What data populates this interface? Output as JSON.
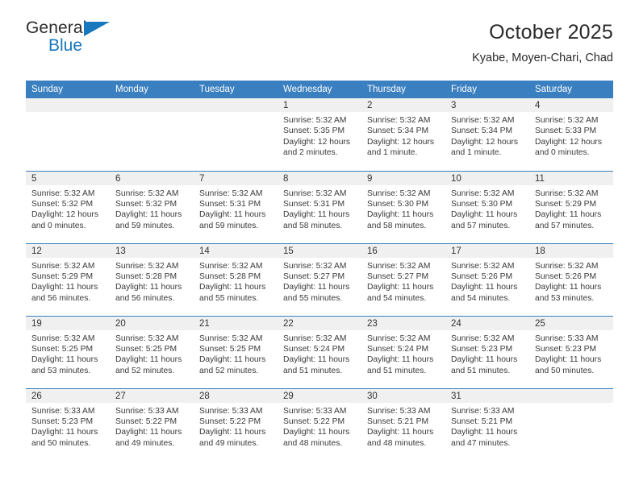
{
  "brand": {
    "name_part1": "General",
    "name_part2": "Blue",
    "accent_color": "#1878be",
    "triangle_icon": "triangle-icon"
  },
  "header": {
    "title": "October 2025",
    "subtitle": "Kyabe, Moyen-Chari, Chad"
  },
  "theme": {
    "header_row_bg": "#3a7fbf",
    "daynum_band_bg": "#f0f0f0",
    "grid_line": "#3a7fbf",
    "text": "#3a3a3a"
  },
  "weekdays": [
    "Sunday",
    "Monday",
    "Tuesday",
    "Wednesday",
    "Thursday",
    "Friday",
    "Saturday"
  ],
  "labels": {
    "sunrise": "Sunrise:",
    "sunset": "Sunset:",
    "daylight": "Daylight:"
  },
  "weeks": [
    [
      {
        "day": "",
        "info": ""
      },
      {
        "day": "",
        "info": ""
      },
      {
        "day": "",
        "info": ""
      },
      {
        "day": "1",
        "info": "Sunrise: 5:32 AM\nSunset: 5:35 PM\nDaylight: 12 hours\nand 2 minutes."
      },
      {
        "day": "2",
        "info": "Sunrise: 5:32 AM\nSunset: 5:34 PM\nDaylight: 12 hours\nand 1 minute."
      },
      {
        "day": "3",
        "info": "Sunrise: 5:32 AM\nSunset: 5:34 PM\nDaylight: 12 hours\nand 1 minute."
      },
      {
        "day": "4",
        "info": "Sunrise: 5:32 AM\nSunset: 5:33 PM\nDaylight: 12 hours\nand 0 minutes."
      }
    ],
    [
      {
        "day": "5",
        "info": "Sunrise: 5:32 AM\nSunset: 5:32 PM\nDaylight: 12 hours\nand 0 minutes."
      },
      {
        "day": "6",
        "info": "Sunrise: 5:32 AM\nSunset: 5:32 PM\nDaylight: 11 hours\nand 59 minutes."
      },
      {
        "day": "7",
        "info": "Sunrise: 5:32 AM\nSunset: 5:31 PM\nDaylight: 11 hours\nand 59 minutes."
      },
      {
        "day": "8",
        "info": "Sunrise: 5:32 AM\nSunset: 5:31 PM\nDaylight: 11 hours\nand 58 minutes."
      },
      {
        "day": "9",
        "info": "Sunrise: 5:32 AM\nSunset: 5:30 PM\nDaylight: 11 hours\nand 58 minutes."
      },
      {
        "day": "10",
        "info": "Sunrise: 5:32 AM\nSunset: 5:30 PM\nDaylight: 11 hours\nand 57 minutes."
      },
      {
        "day": "11",
        "info": "Sunrise: 5:32 AM\nSunset: 5:29 PM\nDaylight: 11 hours\nand 57 minutes."
      }
    ],
    [
      {
        "day": "12",
        "info": "Sunrise: 5:32 AM\nSunset: 5:29 PM\nDaylight: 11 hours\nand 56 minutes."
      },
      {
        "day": "13",
        "info": "Sunrise: 5:32 AM\nSunset: 5:28 PM\nDaylight: 11 hours\nand 56 minutes."
      },
      {
        "day": "14",
        "info": "Sunrise: 5:32 AM\nSunset: 5:28 PM\nDaylight: 11 hours\nand 55 minutes."
      },
      {
        "day": "15",
        "info": "Sunrise: 5:32 AM\nSunset: 5:27 PM\nDaylight: 11 hours\nand 55 minutes."
      },
      {
        "day": "16",
        "info": "Sunrise: 5:32 AM\nSunset: 5:27 PM\nDaylight: 11 hours\nand 54 minutes."
      },
      {
        "day": "17",
        "info": "Sunrise: 5:32 AM\nSunset: 5:26 PM\nDaylight: 11 hours\nand 54 minutes."
      },
      {
        "day": "18",
        "info": "Sunrise: 5:32 AM\nSunset: 5:26 PM\nDaylight: 11 hours\nand 53 minutes."
      }
    ],
    [
      {
        "day": "19",
        "info": "Sunrise: 5:32 AM\nSunset: 5:25 PM\nDaylight: 11 hours\nand 53 minutes."
      },
      {
        "day": "20",
        "info": "Sunrise: 5:32 AM\nSunset: 5:25 PM\nDaylight: 11 hours\nand 52 minutes."
      },
      {
        "day": "21",
        "info": "Sunrise: 5:32 AM\nSunset: 5:25 PM\nDaylight: 11 hours\nand 52 minutes."
      },
      {
        "day": "22",
        "info": "Sunrise: 5:32 AM\nSunset: 5:24 PM\nDaylight: 11 hours\nand 51 minutes."
      },
      {
        "day": "23",
        "info": "Sunrise: 5:32 AM\nSunset: 5:24 PM\nDaylight: 11 hours\nand 51 minutes."
      },
      {
        "day": "24",
        "info": "Sunrise: 5:32 AM\nSunset: 5:23 PM\nDaylight: 11 hours\nand 51 minutes."
      },
      {
        "day": "25",
        "info": "Sunrise: 5:33 AM\nSunset: 5:23 PM\nDaylight: 11 hours\nand 50 minutes."
      }
    ],
    [
      {
        "day": "26",
        "info": "Sunrise: 5:33 AM\nSunset: 5:23 PM\nDaylight: 11 hours\nand 50 minutes."
      },
      {
        "day": "27",
        "info": "Sunrise: 5:33 AM\nSunset: 5:22 PM\nDaylight: 11 hours\nand 49 minutes."
      },
      {
        "day": "28",
        "info": "Sunrise: 5:33 AM\nSunset: 5:22 PM\nDaylight: 11 hours\nand 49 minutes."
      },
      {
        "day": "29",
        "info": "Sunrise: 5:33 AM\nSunset: 5:22 PM\nDaylight: 11 hours\nand 48 minutes."
      },
      {
        "day": "30",
        "info": "Sunrise: 5:33 AM\nSunset: 5:21 PM\nDaylight: 11 hours\nand 48 minutes."
      },
      {
        "day": "31",
        "info": "Sunrise: 5:33 AM\nSunset: 5:21 PM\nDaylight: 11 hours\nand 47 minutes."
      },
      {
        "day": "",
        "info": ""
      }
    ]
  ]
}
